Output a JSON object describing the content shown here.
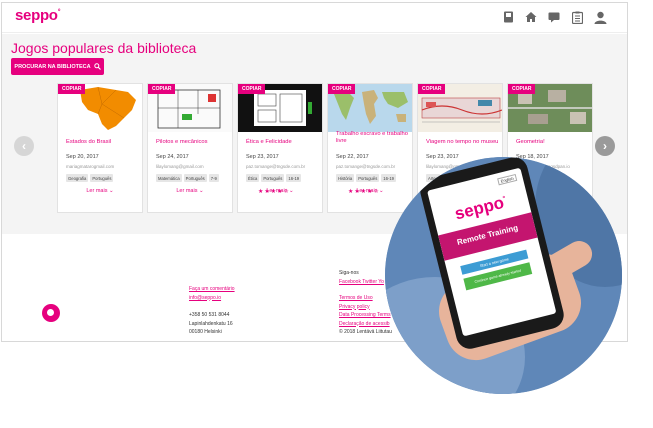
{
  "app": {
    "logo": "seppo",
    "logo_mark": "°"
  },
  "topbar_icons": [
    "book-icon",
    "home-icon",
    "chat-icon",
    "clipboard-icon",
    "user-icon"
  ],
  "main": {
    "title": "Jogos populares da biblioteca",
    "search_button": "PROCURAR NA BIBLIOTECA",
    "copy_label": "COPIAR",
    "read_more": "Ler mais",
    "cards": [
      {
        "title": "Estados do Brasil",
        "date": "Sep 20, 2017",
        "email": "mariagmatarogmail.com",
        "tags": [
          "Geografia",
          "Português"
        ],
        "rating": "",
        "image": "map"
      },
      {
        "title": "Pilotos e mecânicos",
        "date": "Sep 24, 2017",
        "email": "lilaylomang@gmail.com",
        "tags": [
          "Matemática",
          "Português",
          "7-9"
        ],
        "rating": "",
        "image": "floorplan"
      },
      {
        "title": "Ética e Felicidade",
        "date": "Sep 23, 2017",
        "email": "paz.tomange@tngsde.com.br",
        "tags": [
          "Ética",
          "Português",
          "16-19"
        ],
        "rating": "★★★★☆",
        "image": "floorplan-dark"
      },
      {
        "title": "Trabalho escravo e trabalho livre",
        "date": "Sep 22, 2017",
        "email": "paz.tomange@tngsde.com.br",
        "tags": [
          "História",
          "Português",
          "16-19"
        ],
        "rating": "★★★★☆",
        "image": "worldmap"
      },
      {
        "title": "Viagem no tempo no museu",
        "date": "Sep 23, 2017",
        "email": "lilaylomang@gmail.com",
        "tags": [
          "Artes",
          "Português"
        ],
        "rating": "",
        "image": "museum"
      },
      {
        "title": "Geometria!",
        "date": "Sep 18, 2017",
        "email": "paz.tomange@tngsdpan.io",
        "tags": [],
        "rating": "",
        "image": "aerial"
      }
    ]
  },
  "footer": {
    "comment_link": "Faça um comentário",
    "email": "info@seppo.io",
    "phone": "+358 50 531 8044",
    "street": "Lapinlahdenkatu 16",
    "city": "00180 Helsinki",
    "follow": "Siga-nos",
    "social": "Facebook Twitter Yo",
    "terms": "Termos de Uso",
    "privacy": "Privacy policy",
    "dpa": "Data Processing Terms",
    "declaration": "Declaração de acessib",
    "copyright": "© 2018 Lentävä Liitutau"
  },
  "phone": {
    "language": "English",
    "logo": "seppo",
    "heading": "Remote Training",
    "button_primary": "Start a new game",
    "button_secondary": "Continue game already started"
  },
  "colors": {
    "accent": "#e6007e",
    "blue": "#3c9cd4",
    "green": "#4fb848"
  }
}
